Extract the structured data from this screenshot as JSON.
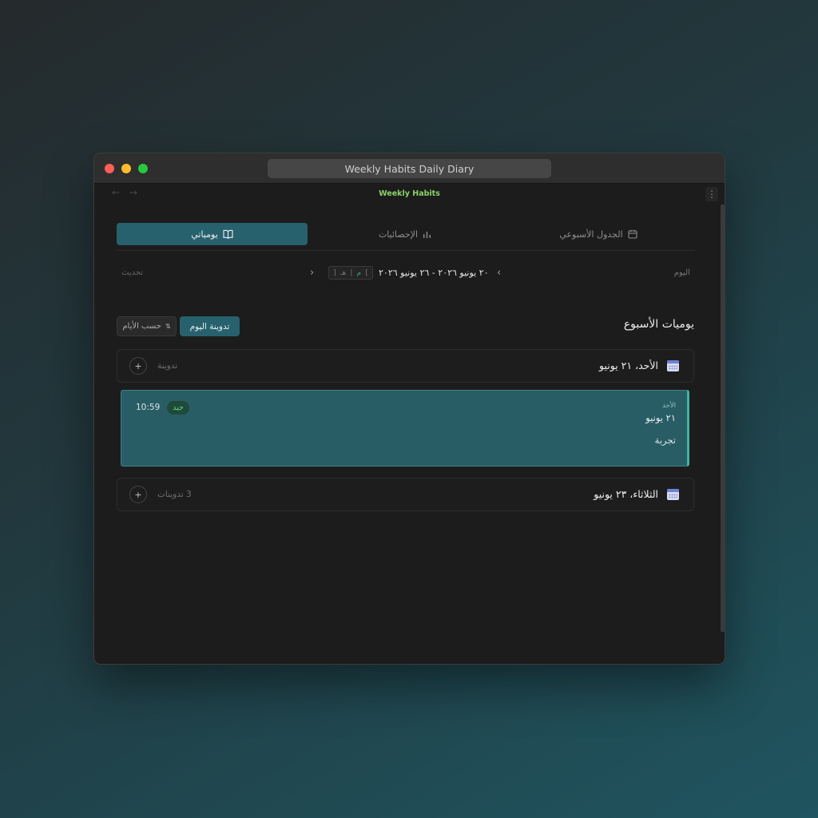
{
  "window": {
    "title": "Weekly Habits Daily Diary",
    "brand": "Weekly Habits"
  },
  "nav": {
    "back_icon": "arrow-left-icon",
    "forward_icon": "arrow-right-icon",
    "menu_icon": "vertical-dots-icon"
  },
  "tabs": [
    {
      "label": "يومياتي",
      "icon": "book-icon",
      "active": true
    },
    {
      "label": "الإحصائيات",
      "icon": "bar-chart-icon",
      "active": false
    },
    {
      "label": "الجدول الأسبوعي",
      "icon": "calendar-icon",
      "active": false
    }
  ],
  "date_nav": {
    "today_label": "اليوم",
    "range": "٢٠ يونيو ٢٠٢٦ - ٢٦ يونيو ٢٠٢٦",
    "calendar_toggle": [
      "م",
      "هـ"
    ],
    "refresh_label": "تحديث"
  },
  "section": {
    "title": "يوميات الأسبوع",
    "today_entry_button": "تدوينة اليوم",
    "sort_button": "حسب الأيام",
    "sort_icon": "sort-arrows-icon"
  },
  "days": [
    {
      "title": "الأحد، ٢١ يونيو",
      "meta": "تدوينة",
      "add_icon": "plus-icon"
    },
    {
      "title": "الثلاثاء، ٢٣ يونيو",
      "meta": "3 تدوينات",
      "add_icon": "plus-icon"
    }
  ],
  "entry": {
    "weekday": "الأحد",
    "date": "٢١ يونيو",
    "text": "تجربة",
    "time": "10:59",
    "mood": "جيد"
  },
  "colors": {
    "accent": "#27616d",
    "brand_green": "#8bd36a",
    "entry_border": "#3fb59d",
    "mood_green": "#63d37a"
  }
}
